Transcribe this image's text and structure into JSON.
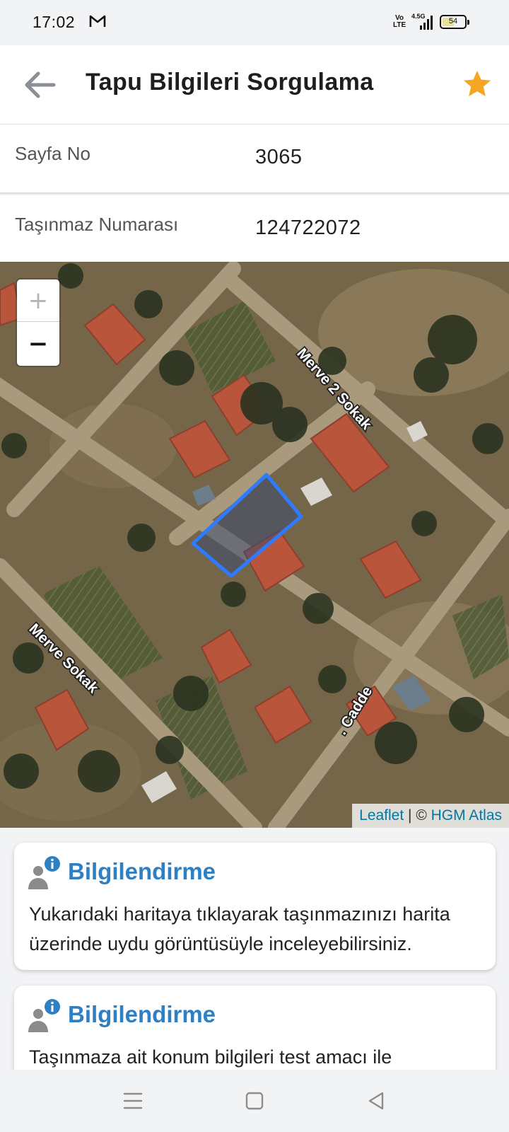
{
  "status_bar": {
    "time": "17:02",
    "volte_label": "Vo LTE",
    "network": "4.5G",
    "battery": "54",
    "battery_level": 0.54
  },
  "app_bar": {
    "title": "Tapu Bilgileri Sorgulama",
    "back_icon": "arrow-left-icon",
    "favorite_icon": "star-icon",
    "accent_color": "#f5a623"
  },
  "fields": [
    {
      "label": "Sayfa No",
      "value": "3065"
    },
    {
      "label": "Taşınmaz Numarası",
      "value": "124722072"
    }
  ],
  "map": {
    "zoom_in_label": "+",
    "zoom_out_label": "−",
    "street_labels": [
      "Merve 2 Sokak",
      "Merve Sokak",
      ". Cadde"
    ],
    "attribution": {
      "leaflet": "Leaflet",
      "separator": " | © ",
      "provider": "HGM Atlas"
    },
    "parcel_color": "#2f7bff"
  },
  "cards": [
    {
      "title": "Bilgilendirme",
      "text": "Yukarıdaki haritaya tıklayarak taşınmazınızı harita üzerinde uydu görüntüsüyle inceleyebilirsiniz."
    },
    {
      "title": "Bilgilendirme",
      "text": "Taşınmaza ait konum bilgileri test amacı ile"
    }
  ],
  "nav_bar": {
    "icons": [
      "menu-icon",
      "home-icon",
      "back-icon"
    ]
  }
}
